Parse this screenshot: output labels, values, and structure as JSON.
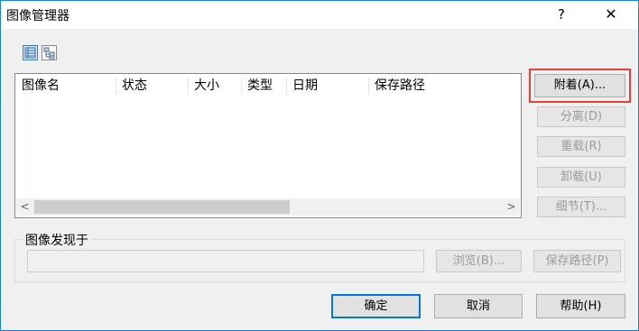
{
  "window": {
    "title": "图像管理器",
    "help_glyph": "?",
    "close_glyph": "✕"
  },
  "toolbar": {
    "views": [
      {
        "icon": "details-view-icon",
        "active": true
      },
      {
        "icon": "tree-view-icon",
        "active": false
      }
    ]
  },
  "list": {
    "columns": [
      "图像名",
      "状态",
      "大小",
      "类型",
      "日期",
      "保存路径"
    ],
    "rows": [],
    "scroll_left_glyph": "<",
    "scroll_right_glyph": ">"
  },
  "side_buttons": {
    "attach": "附着(A)...",
    "detach": "分离(D)",
    "reload": "重载(R)",
    "unload": "卸载(U)",
    "details": "细节(T)..."
  },
  "found_at": {
    "label": "图像发现于",
    "value": "",
    "browse": "浏览(B)...",
    "save_path": "保存路径(P)"
  },
  "footer": {
    "ok": "确定",
    "cancel": "取消",
    "help": "帮助(H)"
  },
  "colors": {
    "highlight_border": "#e8413a",
    "default_button_border": "#0078d7",
    "window_border": "#1883d7"
  }
}
